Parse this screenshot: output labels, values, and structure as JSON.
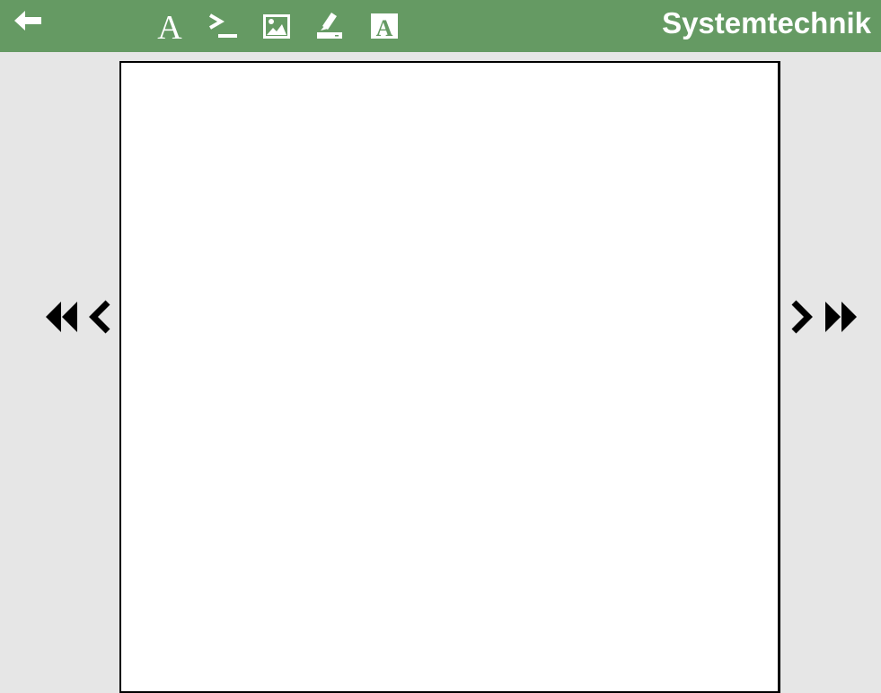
{
  "header": {
    "title": "Systemtechnik",
    "back_icon": "arrow-left-icon",
    "tools": [
      {
        "name": "text-tool",
        "icon": "serif-letter-a-icon"
      },
      {
        "name": "terminal-tool",
        "icon": "terminal-prompt-icon"
      },
      {
        "name": "image-tool",
        "icon": "image-icon"
      },
      {
        "name": "signature-tool",
        "icon": "signature-pen-icon"
      },
      {
        "name": "font-tool",
        "icon": "boxed-letter-a-icon"
      }
    ],
    "text_tool_glyph": "A",
    "font_tool_glyph": "A"
  },
  "colors": {
    "header_bg": "#659a63",
    "page_bg": "#ffffff",
    "workspace_bg": "#e6e6e6",
    "icon_white": "#ffffff",
    "nav_icon": "#000000"
  },
  "navigation": {
    "first_icon": "double-chevron-left-icon",
    "prev_icon": "chevron-left-icon",
    "next_icon": "chevron-right-icon",
    "last_icon": "double-chevron-right-icon"
  }
}
